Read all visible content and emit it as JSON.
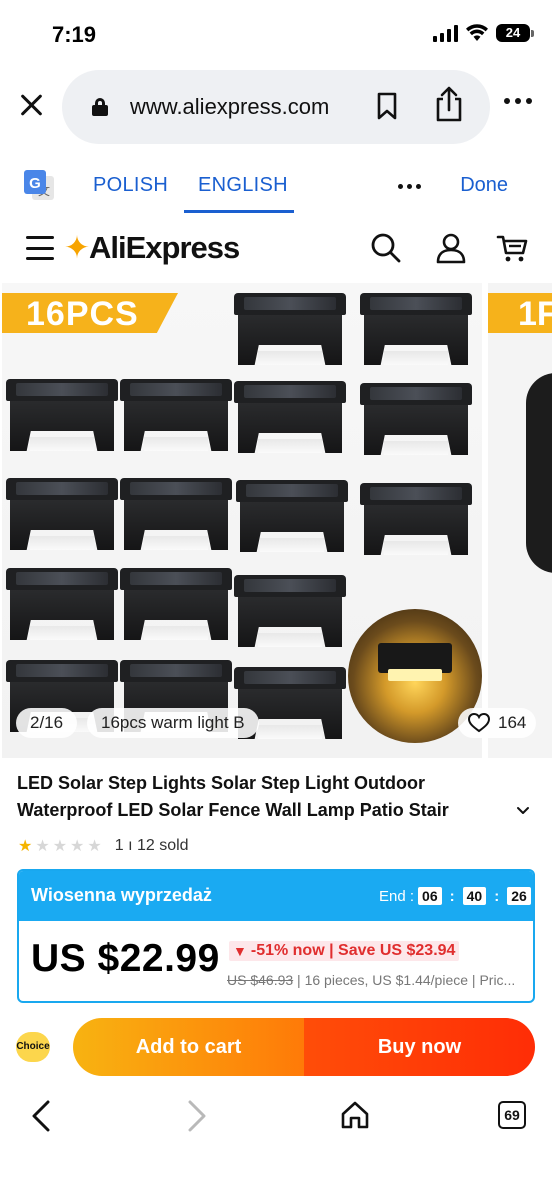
{
  "status_bar": {
    "time": "7:19",
    "battery": "24"
  },
  "browser": {
    "url": "www.aliexpress.com",
    "tabs_count": "69"
  },
  "translate_bar": {
    "source_lang": "POLISH",
    "target_lang": "ENGLISH",
    "done_label": "Done"
  },
  "site": {
    "logo_prefix": "",
    "logo_text": "AliExpress"
  },
  "gallery": {
    "banner_text": "16PCS",
    "next_banner_text": "1F",
    "image_index": "2/16",
    "variant_label": "16pcs warm light B",
    "likes": "164"
  },
  "product": {
    "title": "LED Solar Step Lights Solar Step Light Outdoor Waterproof LED Solar Fence Wall Lamp Patio Stair",
    "rating_stars": 1,
    "sold_text": "1 ı 12 sold"
  },
  "sale": {
    "name": "Wiosenna wyprzedaż",
    "end_label": "End :",
    "hours": "06",
    "minutes": "40",
    "seconds": "26",
    "price": "US $22.99",
    "discount": "-51% now | Save US $23.94",
    "original_price": "US $46.93",
    "details": " | 16 pieces, US $1.44/piece | Pric..."
  },
  "actions": {
    "choice_badge": "Choice",
    "add_to_cart": "Add to cart",
    "buy_now": "Buy now"
  },
  "colors": {
    "accent_blue": "#1a5fd0",
    "sale_blue": "#1aaaf2",
    "orange": "#ff7a08",
    "red": "#ff2d06",
    "star": "#f5b400"
  }
}
